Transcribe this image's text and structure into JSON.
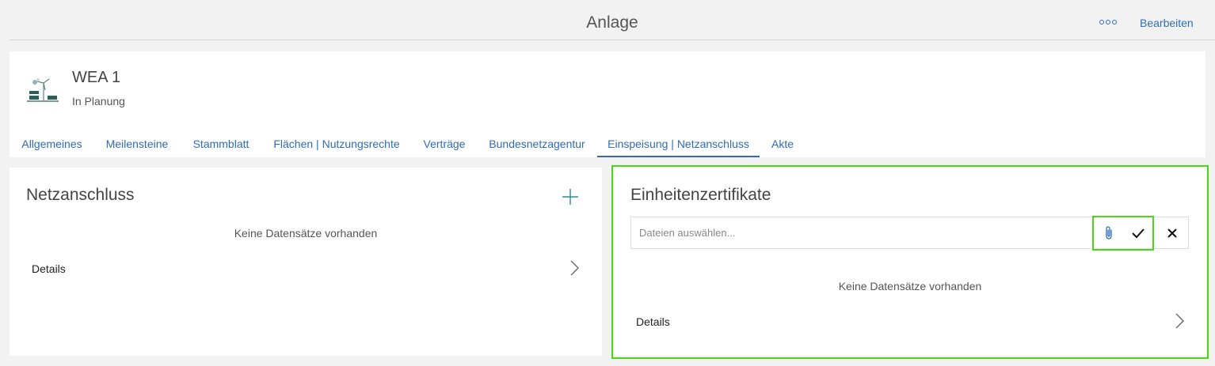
{
  "header": {
    "title": "Anlage",
    "more_icon": "more-dots-icon",
    "edit_label": "Bearbeiten"
  },
  "asset": {
    "icon": "wind-solar-plant-icon",
    "name": "WEA 1",
    "status": "In Planung"
  },
  "tabs": [
    {
      "label": "Allgemeines",
      "active": false
    },
    {
      "label": "Meilensteine",
      "active": false
    },
    {
      "label": "Stammblatt",
      "active": false
    },
    {
      "label": "Flächen | Nutzungsrechte",
      "active": false
    },
    {
      "label": "Verträge",
      "active": false
    },
    {
      "label": "Bundesnetzagentur",
      "active": false
    },
    {
      "label": "Einspeisung | Netzanschluss",
      "active": true
    },
    {
      "label": "Akte",
      "active": false
    }
  ],
  "netzanschluss": {
    "title": "Netzanschluss",
    "add_icon": "plus-icon",
    "empty_text": "Keine Datensätze vorhanden",
    "details_label": "Details"
  },
  "zertifikate": {
    "title": "Einheitenzertifikate",
    "upload_placeholder": "Dateien auswählen...",
    "attach_icon": "paperclip-icon",
    "confirm_icon": "checkmark-icon",
    "cancel_icon": "close-icon",
    "empty_text": "Keine Datensätze vorhanden",
    "details_label": "Details"
  },
  "colors": {
    "accent": "#2f6db5",
    "highlight": "#4cd617",
    "background": "#f2f2f2"
  }
}
